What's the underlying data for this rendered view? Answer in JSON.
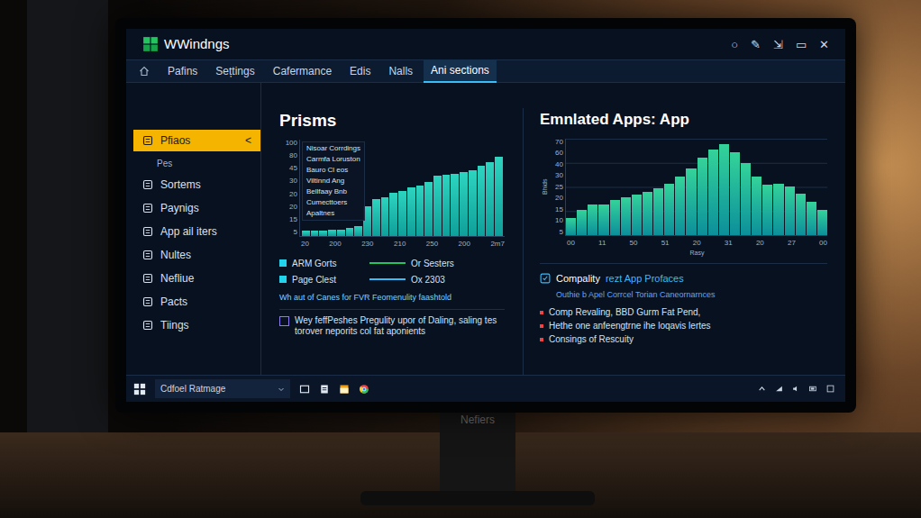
{
  "monitor": {
    "brand": "Nefiers"
  },
  "window": {
    "title": "WWindngs",
    "controls": [
      "○",
      "✎",
      "⇲",
      "▭",
      "✕"
    ]
  },
  "tabs": [
    {
      "label": "Pafins",
      "selected": false
    },
    {
      "label": "Sețtings",
      "selected": false
    },
    {
      "label": "Cafermance",
      "selected": false
    },
    {
      "label": "Edis",
      "selected": false
    },
    {
      "label": "Nalls",
      "selected": false
    },
    {
      "label": "Ani sections",
      "selected": true
    }
  ],
  "sidebar": {
    "collapse": "<",
    "items": [
      {
        "label": "Pfiaos",
        "kind": "item",
        "selected": true
      },
      {
        "label": "Pes",
        "kind": "sub",
        "selected": false
      },
      {
        "label": "Sortems",
        "kind": "item",
        "selected": false
      },
      {
        "label": "Paynigs",
        "kind": "item",
        "selected": false
      },
      {
        "label": "App ail iters",
        "kind": "item",
        "selected": false
      },
      {
        "label": "Nultes",
        "kind": "item",
        "selected": false
      },
      {
        "label": "Nefliue",
        "kind": "item",
        "selected": false
      },
      {
        "label": "Pacts",
        "kind": "item",
        "selected": false
      },
      {
        "label": "Tiings",
        "kind": "item",
        "selected": false
      }
    ]
  },
  "prisms_chart": {
    "title": "Prisms",
    "y_ticks": [
      "100",
      "80",
      "45",
      "30",
      "20",
      "20",
      "15",
      "5"
    ],
    "x_ticks": [
      "20",
      "200",
      "230",
      "210",
      "250",
      "200",
      "2m7"
    ],
    "categories": [
      "Nisoar Corrdings",
      "Carmfa Loruston",
      "Bauro Cl eos",
      "Viltinnd Ang",
      "Bellfaay Bnb",
      "Cumecttoers",
      "Apaltnes"
    ],
    "values": [
      5,
      5,
      5,
      6,
      6,
      8,
      10,
      30,
      38,
      40,
      44,
      46,
      50,
      52,
      56,
      62,
      63,
      64,
      66,
      68,
      72,
      76,
      82
    ],
    "legend": [
      {
        "label": "ARM Gorts",
        "line_label": "Or Sesters",
        "color": "#22c55e"
      },
      {
        "label": "Page Clest",
        "line_label": "Ox 2303",
        "color": "#38bdf8"
      }
    ],
    "note": "Wh aut of Canes for FVR Feomenulity faashtold",
    "option": {
      "label": "Wey feffPeshes Pregulity upor of Daling, saling tes torover neporits col fat aponients",
      "checked": false
    }
  },
  "emulated_chart": {
    "title": "Emnlated Apps: App",
    "y_label": "Bhids",
    "x_label": "Rasy",
    "y_ticks": [
      "70",
      "60",
      "40",
      "30",
      "25",
      "20",
      "15",
      "10",
      "5"
    ],
    "x_ticks": [
      "00",
      "11",
      "50",
      "51",
      "20",
      "31",
      "20",
      "27",
      "00"
    ],
    "values": [
      12,
      18,
      22,
      22,
      25,
      27,
      29,
      31,
      34,
      37,
      42,
      48,
      56,
      62,
      66,
      60,
      52,
      42,
      36,
      37,
      35,
      30,
      24,
      18
    ]
  },
  "compatibility": {
    "title": "Compality",
    "link": "rezt App Profaces",
    "subtitle": "Outhie b Apel Corrcel Torian Caneornarnces",
    "bullets": [
      "Comp Revaling, BBD Gurm Fat Pend,",
      "Hethe one anfeengtrne ihe loqavis lertes",
      "Consings of Rescuity"
    ]
  },
  "taskbar": {
    "search": "Cdfoel Ratmage"
  }
}
